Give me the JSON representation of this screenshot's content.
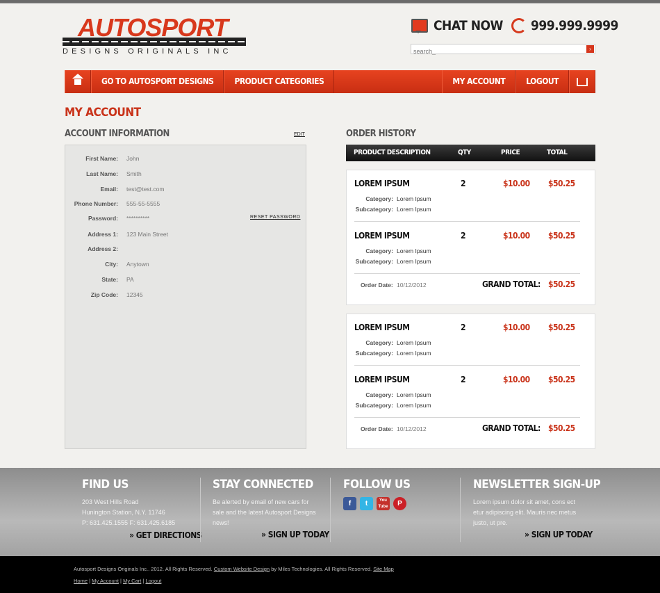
{
  "header": {
    "logo_text": "AUTOSPORT",
    "logo_sub": "DESIGNS ORIGINALS INC",
    "chat_label": "CHAT NOW",
    "phone": "999.999.9999",
    "search_placeholder": "search_",
    "search_button": "›"
  },
  "nav": {
    "item1": "GO TO AUTOSPORT DESIGNS",
    "item2": "PRODUCT CATEGORIES",
    "my_account": "MY ACCOUNT",
    "logout": "LOGOUT"
  },
  "page": {
    "title": "MY ACCOUNT"
  },
  "account": {
    "title": "ACCOUNT INFORMATION",
    "edit": "EDIT",
    "reset_password": "RESET PASSWORD",
    "fields": [
      {
        "label": "First Name:",
        "value": "John"
      },
      {
        "label": "Last Name:",
        "value": "Smith"
      },
      {
        "label": "Email:",
        "value": "test@test.com"
      },
      {
        "label": "Phone Number:",
        "value": "555-55-5555"
      },
      {
        "label": "Password:",
        "value": "**********"
      },
      {
        "label": "Address 1:",
        "value": "123 Main Street"
      },
      {
        "label": "Address 2:",
        "value": ""
      },
      {
        "label": "City:",
        "value": "Anytown"
      },
      {
        "label": "State:",
        "value": "PA"
      },
      {
        "label": "Zip Code:",
        "value": "12345"
      }
    ]
  },
  "orders": {
    "title": "ORDER HISTORY",
    "columns": {
      "desc": "PRODUCT DESCRIPTION",
      "qty": "QTY",
      "price": "PRICE",
      "total": "TOTAL"
    },
    "list": [
      {
        "items": [
          {
            "name": "LOREM IPSUM",
            "qty": "2",
            "price": "$10.00",
            "total": "$50.25",
            "category_label": "Category:",
            "category": "Lorem Ipsum",
            "subcategory_label": "Subcategory:",
            "subcategory": "Lorem Ipsum"
          },
          {
            "name": "LOREM IPSUM",
            "qty": "2",
            "price": "$10.00",
            "total": "$50.25",
            "category_label": "Category:",
            "category": "Lorem Ipsum",
            "subcategory_label": "Subcategory:",
            "subcategory": "Lorem Ipsum"
          }
        ],
        "order_date_label": "Order Date:",
        "order_date": "10/12/2012",
        "grand_total_label": "GRAND TOTAL:",
        "grand_total": "$50.25"
      },
      {
        "items": [
          {
            "name": "LOREM IPSUM",
            "qty": "2",
            "price": "$10.00",
            "total": "$50.25",
            "category_label": "Category:",
            "category": "Lorem Ipsum",
            "subcategory_label": "Subcategory:",
            "subcategory": "Lorem Ipsum"
          },
          {
            "name": "LOREM IPSUM",
            "qty": "2",
            "price": "$10.00",
            "total": "$50.25",
            "category_label": "Category:",
            "category": "Lorem Ipsum",
            "subcategory_label": "Subcategory:",
            "subcategory": "Lorem Ipsum"
          }
        ],
        "order_date_label": "Order Date:",
        "order_date": "10/12/2012",
        "grand_total_label": "GRAND TOTAL:",
        "grand_total": "$50.25"
      }
    ]
  },
  "footer": {
    "find_us": {
      "title": "FIND US",
      "address1": "203 West Hills Road",
      "address2": "Hunington Station, N.Y. 11746",
      "phones": "P: 631.425.1555   F: 631.425.6185",
      "cta": "GET DIRECTIONS"
    },
    "stay_connected": {
      "title": "STAY CONNECTED",
      "text": "Be alerted by email of new cars for sale and the latest Autosport Designs news!",
      "cta": "SIGN UP TODAY"
    },
    "follow_us": {
      "title": "FOLLOW US",
      "icons": [
        "facebook-icon",
        "twitter-icon",
        "youtube-icon",
        "pinterest-icon"
      ],
      "facebook": "f",
      "twitter": "t",
      "youtube": "You Tube",
      "pinterest": "P"
    },
    "newsletter": {
      "title": "NEWSLETTER SIGN-UP",
      "text": "Lorem ipsum dolor sit amet, cons ect etur adipiscing elit. Mauris nec metus justo, ut pre.",
      "cta": "SIGN UP TODAY"
    }
  },
  "bottom": {
    "copyright_prefix": "Autosport Designs Originals Inc.. 2012. All Rights Reserved.",
    "custom_design": "Custom Website Design",
    "copyright_mid": "by Miles Technologies. All Rights Reserved.",
    "site_map": "Site Map",
    "links": {
      "home": "Home",
      "my_account": "My Account",
      "my_cart": "My Cart",
      "logout": "Logout"
    },
    "sep": "|"
  },
  "colors": {
    "accent": "#d6361c",
    "footer_gray": "#a8a8a8",
    "dark": "#000000"
  }
}
